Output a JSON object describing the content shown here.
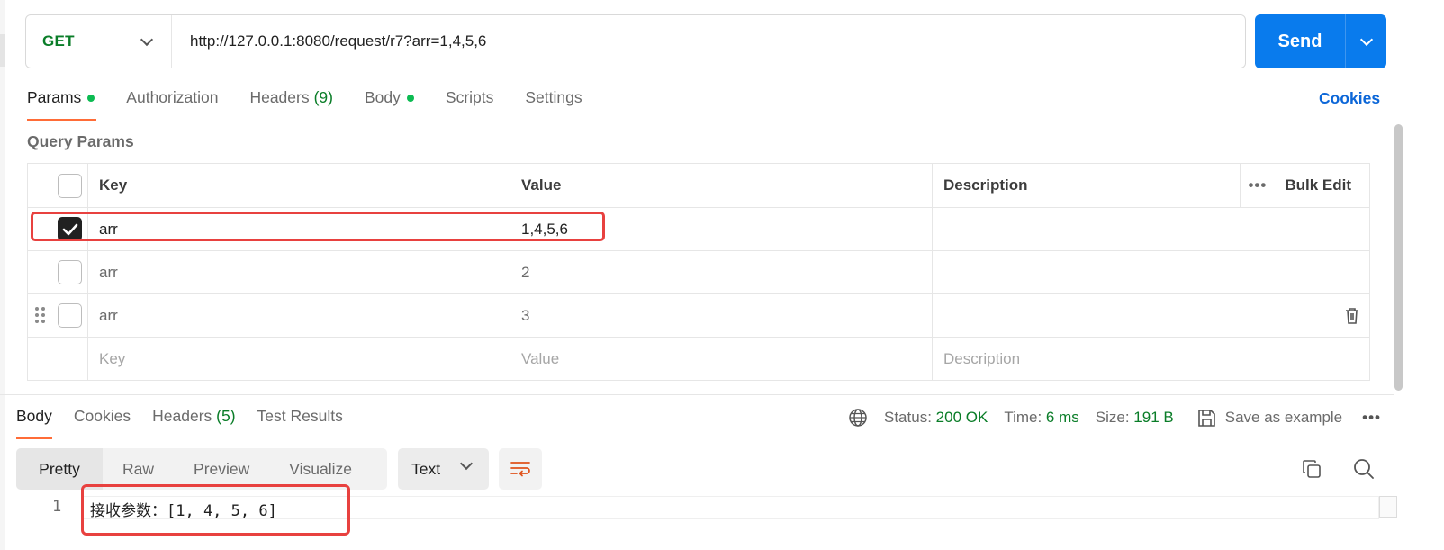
{
  "request": {
    "method": "GET",
    "url": "http://127.0.0.1:8080/request/r7?arr=1,4,5,6",
    "send_label": "Send"
  },
  "tabs": [
    {
      "label": "Params",
      "indicator": true,
      "active": true
    },
    {
      "label": "Authorization"
    },
    {
      "label": "Headers",
      "count": "(9)"
    },
    {
      "label": "Body",
      "indicator": true
    },
    {
      "label": "Scripts"
    },
    {
      "label": "Settings"
    }
  ],
  "cookies_label": "Cookies",
  "query_params": {
    "title": "Query Params",
    "columns": {
      "key": "Key",
      "value": "Value",
      "description": "Description"
    },
    "bulk_edit_label": "Bulk Edit",
    "rows": [
      {
        "checked": true,
        "key": "arr",
        "value": "1,4,5,6",
        "description": ""
      },
      {
        "checked": false,
        "key": "arr",
        "value": "2",
        "description": ""
      },
      {
        "checked": false,
        "key": "arr",
        "value": "3",
        "description": ""
      }
    ],
    "placeholders": {
      "key": "Key",
      "value": "Value",
      "description": "Description"
    }
  },
  "response": {
    "tabs": [
      {
        "label": "Body",
        "active": true
      },
      {
        "label": "Cookies"
      },
      {
        "label": "Headers",
        "count": "(5)"
      },
      {
        "label": "Test Results"
      }
    ],
    "status_label": "Status:",
    "status_value": "200 OK",
    "time_label": "Time:",
    "time_value": "6 ms",
    "size_label": "Size:",
    "size_value": "191 B",
    "save_example_label": "Save as example",
    "formats": [
      "Pretty",
      "Raw",
      "Preview",
      "Visualize"
    ],
    "active_format": "Pretty",
    "content_type": "Text",
    "lines": [
      {
        "number": "1",
        "text": "接收参数：[1, 4, 5, 6]"
      }
    ]
  },
  "colors": {
    "accent_send": "#097bed",
    "method_green": "#0a7d28",
    "active_tab_underline": "#ff6c37",
    "highlight_red": "#e8413f",
    "link_blue": "#0b66d8"
  },
  "icons": [
    "chevron-down-icon",
    "checkmark-icon",
    "drag-handle-icon",
    "trash-icon",
    "globe-icon",
    "save-icon",
    "more-icon",
    "wrap-icon",
    "copy-icon",
    "search-icon"
  ]
}
